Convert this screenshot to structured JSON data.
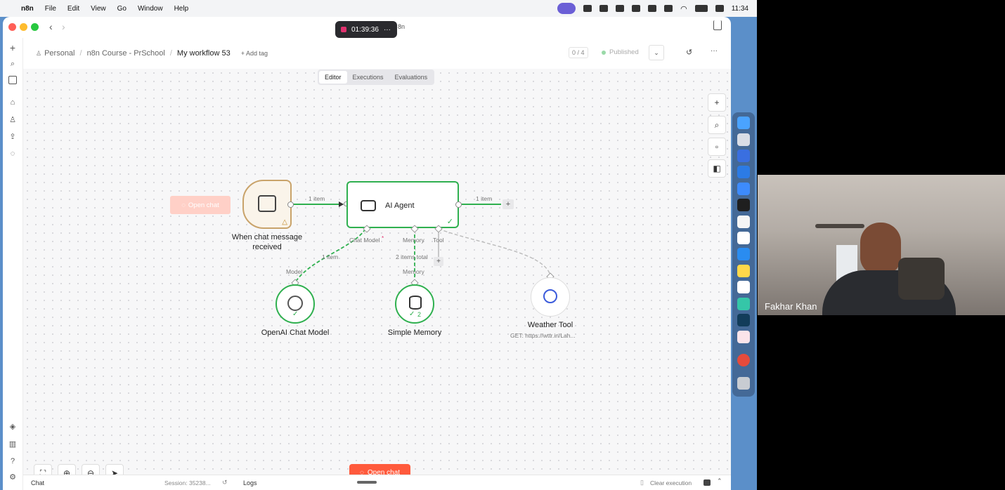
{
  "menubar": {
    "app": "n8n",
    "items": [
      "File",
      "Edit",
      "View",
      "Go",
      "Window",
      "Help"
    ],
    "clock": "11:34"
  },
  "recording": {
    "time": "01:39:36",
    "dots": "···",
    "app_suffix": "8n"
  },
  "header": {
    "breadcrumb": [
      "Personal",
      "n8n Course - PrSchool"
    ],
    "workflow_name": "My workflow 53",
    "add_tag": "+ Add tag",
    "counter": "0 / 4",
    "status": "Published",
    "more": "···"
  },
  "tabs": [
    "Editor",
    "Executions",
    "Evaluations"
  ],
  "nodes": {
    "trigger": {
      "label": "When chat message received",
      "open_chat": "Open chat"
    },
    "agent": {
      "label": "AI Agent"
    },
    "openai": {
      "label": "OpenAI Chat Model"
    },
    "memory": {
      "label": "Simple Memory",
      "badge": "2"
    },
    "weather": {
      "label": "Weather Tool",
      "subtitle": "GET: https://wttr.in/Lah..."
    }
  },
  "connections": {
    "trigger_to_agent": "1 item",
    "agent_out": "1 item",
    "chat_model_port": "Chat Model",
    "memory_port": "Memory",
    "tool_port": "Tool",
    "model_items": "1 item",
    "memory_items": "2 items total",
    "model_label": "Model",
    "memory_label": "Memory"
  },
  "canvas_controls": {
    "open_chat": "Open chat"
  },
  "footer": {
    "chat": "Chat",
    "session": "Session: 35238...",
    "logs": "Logs",
    "clear": "Clear execution"
  },
  "video": {
    "name": "Fakhar Khan"
  },
  "colors": {
    "accent": "#ff5a3c",
    "success": "#2fb04f",
    "trigger_border": "#c9a36a"
  }
}
